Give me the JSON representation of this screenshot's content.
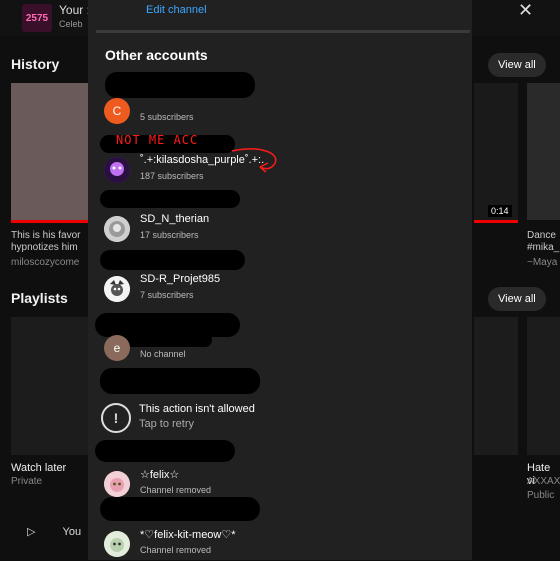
{
  "background": {
    "logo_text": "2575",
    "title": "Your :",
    "subtitle": "Celeb",
    "history_title": "History",
    "playlists_title": "Playlists",
    "view_all": "View all",
    "video_left_line1": "This is his favor",
    "video_left_line2": "hypnotizes him",
    "video_left_channel": "miloscozycome",
    "video_right_line1": "Dance",
    "video_right_line2": "#mika_",
    "video_right_channel": "~Maya",
    "duration": "0:14",
    "watch_later": "Watch later",
    "watch_later_sub": "Private",
    "hate_title": "Hate vi",
    "hate_sub1": "AXXAX",
    "hate_sub2": "Public",
    "bottom_label": "You"
  },
  "sheet": {
    "edit_channel": "Edit channel",
    "other_accounts": "Other accounts",
    "accounts": [
      {
        "avatar_letter": "C",
        "name": "",
        "subs": "5 subscribers",
        "avatar_color": "#ef5a1f"
      },
      {
        "avatar_letter": "",
        "name": "˚.+:kilasdosha_purple˚.+:.",
        "subs": "187 subscribers",
        "avatar_color": "#6a2a9a"
      },
      {
        "avatar_letter": "",
        "name": "SD_N_therian",
        "subs": "17 subscribers",
        "avatar_color": "#d8d8d8"
      },
      {
        "avatar_letter": "",
        "name": "SD-R_Projet985",
        "subs": "7 subscribers",
        "avatar_color": "#eeeeee"
      },
      {
        "avatar_letter": "e",
        "name": "",
        "subs": "No channel",
        "avatar_color": "#8a6a5a"
      },
      {
        "avatar_letter": "",
        "name": "☆felix☆",
        "subs": "Channel removed",
        "avatar_color": "#f0c0c8"
      },
      {
        "avatar_letter": "",
        "name": "*♡felix-kit-meow♡*",
        "subs": "Channel removed",
        "avatar_color": "#d8e8d0"
      }
    ],
    "warning_title": "This action isn't allowed",
    "warning_retry": "Tap to retry",
    "annotation": "NOT ME ACC"
  }
}
